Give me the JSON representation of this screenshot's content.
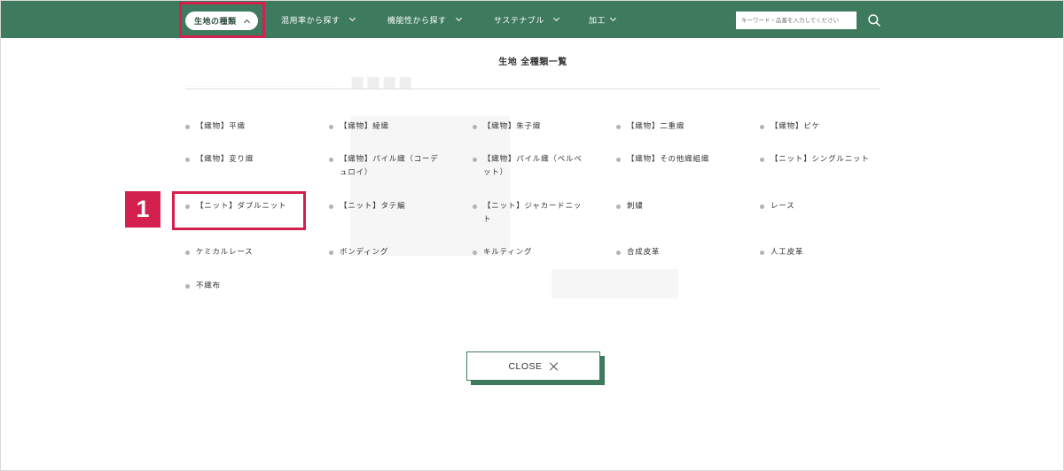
{
  "nav": {
    "items": [
      {
        "label": "生地の種類"
      },
      {
        "label": "混用率から探す"
      },
      {
        "label": "機能性から探す"
      },
      {
        "label": "サステナブル"
      },
      {
        "label": "加工"
      }
    ],
    "search_placeholder": "キーワード・品番を入力してください"
  },
  "panel": {
    "title": "生地 全種類一覧",
    "items": [
      "【織物】平織",
      "【織物】綾織",
      "【織物】朱子織",
      "【織物】二重織",
      "【織物】ピケ",
      "【織物】変り織",
      "【織物】パイル織（コーデュロイ）",
      "【織物】パイル織（ベルベット）",
      "【織物】その他織組織",
      "【ニット】シングルニット",
      "【ニット】ダブルニット",
      "【ニット】タテ編",
      "【ニット】ジャカードニット",
      "刺繍",
      "レース",
      "ケミカルレース",
      "ボンディング",
      "キルティング",
      "合成皮革",
      "人工皮革",
      "不織布"
    ]
  },
  "close_label": "CLOSE",
  "step_badge": "1",
  "colors": {
    "nav_bg": "#3e7a5e",
    "highlight": "#d3204e",
    "bullet": "#b3b3b3"
  }
}
